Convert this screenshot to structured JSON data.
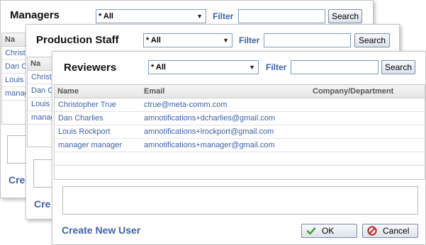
{
  "panels": {
    "managers": {
      "title": "Managers",
      "filter_select": "* All",
      "filter_label": "Filter",
      "search_label": "Search",
      "grid_header_name": "Na",
      "rows": [
        "Christoph",
        "Dan Cl",
        "Louis R",
        "manag"
      ],
      "create_label": "Crea"
    },
    "production": {
      "title": "Production Staff",
      "filter_select": "* All",
      "filter_label": "Filter",
      "search_label": "Search",
      "grid_header_name": "Na",
      "rows": [
        "Christo",
        "Dan Ch",
        "Louis R",
        "manag"
      ],
      "create_label": "Cre"
    },
    "reviewers": {
      "title": "Reviewers",
      "filter_select": "* All",
      "filter_label": "Filter",
      "search_label": "Search",
      "columns": [
        "Name",
        "Email",
        "Company/Department"
      ],
      "rows": [
        {
          "name": "Christopher True",
          "email": "ctrue@meta-comm.com",
          "company": ""
        },
        {
          "name": "Dan Charlies",
          "email": "amnotifications+dcharlies@gmail.com",
          "company": ""
        },
        {
          "name": "Louis Rockport",
          "email": "amnotifications+lrockport@gmail.com",
          "company": ""
        },
        {
          "name": "manager manager",
          "email": "amnotifications+manager@gmail.com",
          "company": ""
        }
      ],
      "create_label": "Create New User",
      "ok_label": "OK",
      "cancel_label": "Cancel"
    }
  },
  "colors": {
    "link": "#3f62a3",
    "ok_icon": "#3a9a2e",
    "cancel_icon": "#c42222"
  }
}
